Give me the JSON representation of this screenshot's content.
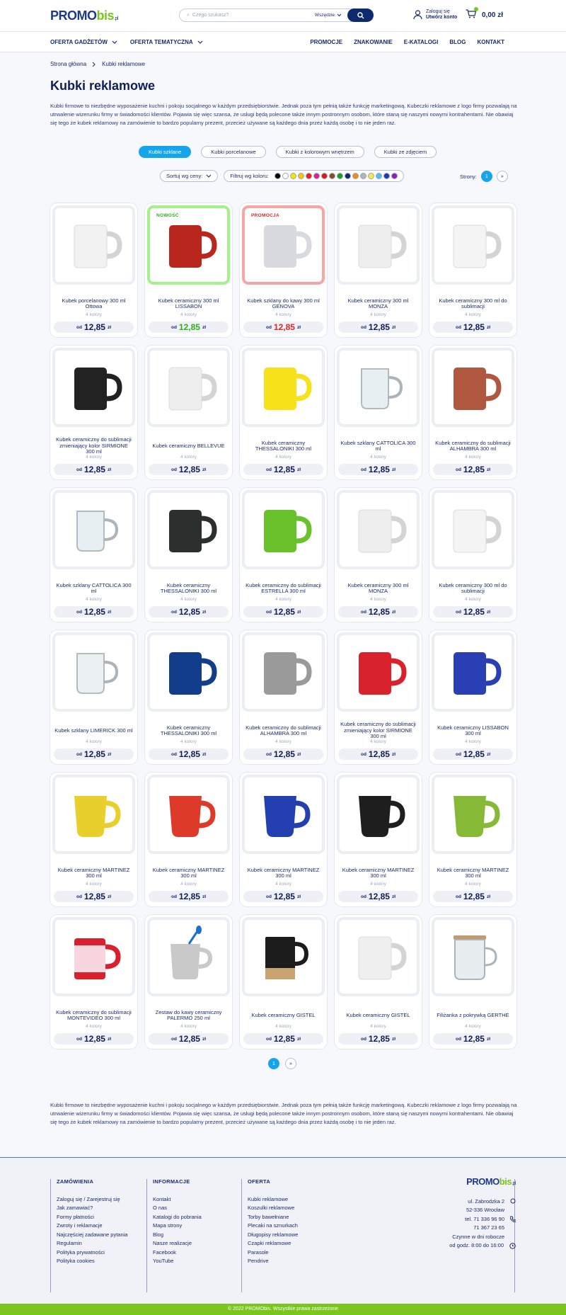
{
  "header": {
    "logo_main": "PROMO",
    "logo_accent": "bis",
    "logo_suffix": ".pl",
    "search_placeholder": "Czego szukasz?",
    "search_scope": "Wszędzie",
    "account_line1": "Zaloguj się",
    "account_line2": "Utwórz konto",
    "cart_total": "0,00 zł"
  },
  "nav": {
    "left": [
      "OFERTA GADŻETÓW",
      "OFERTA TEMATYCZNA"
    ],
    "right": [
      "PROMOCJE",
      "ZNAKOWANIE",
      "E-KATALOGI",
      "BLOG",
      "KONTAKT"
    ]
  },
  "breadcrumb": [
    "Strona główna",
    "Kubki reklamowe"
  ],
  "page_title": "Kubki reklamowe",
  "description": "Kubki firmowe to niezbędne wyposażenie kuchni i pokoju socjalnego w każdym przedsiębiorstwie. Jednak poza tym pełnią także funkcję marketingową. Kubeczki reklamowe z logo firmy pozwalają na utrwalenie wizerunku firmy w świadomości klientów. Pojawia się więc szansa, że usługi będą polecone także innym postronnym osobom, które staną się naszymi nowymi kontrahentami. Nie obawiaj się tego że kubek reklamowy na zamówienie to bardzo popularny prezent, przecież używane są każdego dnia przez każdą osobę i to nie jeden raz.",
  "categories": [
    "Kubki szklane",
    "Kubki porcelanowe",
    "Kubki z kolorowym wnętrzem",
    "Kubki ze zdjęciem"
  ],
  "sort_label": "Sortuj wg ceny:",
  "filter_label": "Filtruj wg koloru:",
  "swatch_colors": [
    "#000000",
    "#ffffff",
    "#f5e400",
    "#f7c600",
    "#f21d1d",
    "#e01f8f",
    "#d51b1b",
    "#8a4b24",
    "#1f9c2a",
    "#0f2a6e",
    "#f08a1e",
    "#b4b4b4",
    "#f5e94a",
    "#5bb8f0",
    "#1a3ab8",
    "#8a1fb8"
  ],
  "pages_label": "Strony:",
  "pages": {
    "current": "1",
    "next": "»"
  },
  "price_prefix": "od",
  "price_currency": "zł",
  "products": [
    {
      "name": "Kubek porcelanowy 300 ml Ottowa",
      "colors": "4 kolory",
      "price": "12,85",
      "badge": "",
      "mug": "#f2f2f2",
      "type": "white"
    },
    {
      "name": "Kubek ceramiczny 300 ml LISSABON",
      "colors": "4 kolory",
      "price": "12,85",
      "badge": "NOWOŚĆ",
      "mug": "#b8261e",
      "type": "solid"
    },
    {
      "name": "Kubek szklany do kawy 300 ml GENOVA",
      "colors": "4 kolory",
      "price": "12,85",
      "badge": "PROMOCJA",
      "mug": "#d8dadf",
      "type": "frosted"
    },
    {
      "name": "Kubek ceramiczny 300 ml MONZA",
      "colors": "4 kolory",
      "price": "12,85",
      "badge": "",
      "mug": "#eeeeee",
      "type": "white"
    },
    {
      "name": "Kubek ceramiczny 300 ml do sublimacji",
      "colors": "4 kolory",
      "price": "12,85",
      "badge": "",
      "mug": "#f4f4f4",
      "type": "white"
    },
    {
      "name": "Kubek ceramiczny do sublimacji zmieniający kolor SIRMIONE 300 ml",
      "colors": "4 kolory",
      "price": "12,85",
      "badge": "",
      "mug": "#222222",
      "type": "solid"
    },
    {
      "name": "Kubek ceramiczny BELLEVUE",
      "colors": "4 kolory",
      "price": "12,85",
      "badge": "",
      "mug": "#eeeeee",
      "type": "white"
    },
    {
      "name": "Kubek ceramiczny THESSALONIKI 300 ml",
      "colors": "4 kolory",
      "price": "12,85",
      "badge": "",
      "mug": "#f7e11a",
      "type": "solid"
    },
    {
      "name": "Kubek szklany CATTOLICA 300 ml",
      "colors": "4 kolory",
      "price": "12,85",
      "badge": "",
      "mug": "#e6eef2",
      "type": "glass"
    },
    {
      "name": "Kubek ceramiczny do sublimacji ALHAMBRA 300 ml",
      "colors": "4 kolory",
      "price": "12,85",
      "badge": "",
      "mug": "#b0573f",
      "type": "solid"
    },
    {
      "name": "Kubek szklany CATTOLICA 300 ml",
      "colors": "4 kolory",
      "price": "12,85",
      "badge": "",
      "mug": "#e6eef2",
      "type": "glass"
    },
    {
      "name": "Kubek ceramiczny THESSALONIKI 300 ml",
      "colors": "4 kolory",
      "price": "12,85",
      "badge": "",
      "mug": "#2b2f2e",
      "type": "solid"
    },
    {
      "name": "Kubek ceramiczny do sublimacji ESTRELLA 300 ml",
      "colors": "4 kolory",
      "price": "12,85",
      "badge": "",
      "mug": "#69c12c",
      "type": "solid"
    },
    {
      "name": "Kubek ceramiczny 300 ml MONZA",
      "colors": "4 kolory",
      "price": "12,85",
      "badge": "",
      "mug": "#eeeeee",
      "type": "white"
    },
    {
      "name": "Kubek ceramiczny 300 ml do sublimacji",
      "colors": "4 kolory",
      "price": "12,85",
      "badge": "",
      "mug": "#f4f4f4",
      "type": "white"
    },
    {
      "name": "Kubek szklany LIMERICK 300 ml",
      "colors": "4 kolory",
      "price": "12,85",
      "badge": "",
      "mug": "#e9efef",
      "type": "glass"
    },
    {
      "name": "Kubek ceramiczny THESSALONIKI 300 ml",
      "colors": "4 kolory",
      "price": "12,85",
      "badge": "",
      "mug": "#123d8a",
      "type": "solid"
    },
    {
      "name": "Kubek ceramiczny do sublimacji ALHAMBRA 300 ml",
      "colors": "4 kolory",
      "price": "12,85",
      "badge": "",
      "mug": "#9a9a9a",
      "type": "solid"
    },
    {
      "name": "Kubek ceramiczny do sublimacji zmieniający kolor SIRMIONE 300 ml",
      "colors": "4 kolory",
      "price": "12,85",
      "badge": "",
      "mug": "#d8232d",
      "type": "solid"
    },
    {
      "name": "Kubek ceramiczny LISSABON 300 ml",
      "colors": "4 kolory",
      "price": "12,85",
      "badge": "",
      "mug": "#2a3fb4",
      "type": "solid"
    },
    {
      "name": "Kubek ceramiczny MARTINEZ 300 ml",
      "colors": "4 kolory",
      "price": "12,85",
      "badge": "",
      "mug": "#e9cf2b",
      "type": "martinez"
    },
    {
      "name": "Kubek ceramiczny MARTINEZ 300 ml",
      "colors": "4 kolory",
      "price": "12,85",
      "badge": "",
      "mug": "#dd3a2a",
      "type": "martinez"
    },
    {
      "name": "Kubek ceramiczny MARTINEZ 300 ml",
      "colors": "4 kolory",
      "price": "12,85",
      "badge": "",
      "mug": "#2440b0",
      "type": "martinez"
    },
    {
      "name": "Kubek ceramiczny MARTINEZ 300 ml",
      "colors": "4 kolory",
      "price": "12,85",
      "badge": "",
      "mug": "#1e1e1e",
      "type": "martinez"
    },
    {
      "name": "Kubek ceramiczny MARTINEZ 300 ml",
      "colors": "4 kolory",
      "price": "12,85",
      "badge": "",
      "mug": "#85b936",
      "type": "martinez"
    },
    {
      "name": "Kubek ceramiczny do sublimacji MONTEVIDEO 300 ml",
      "colors": "4 kolory",
      "price": "12,85",
      "badge": "",
      "mug": "#d8202f",
      "type": "montevideo"
    },
    {
      "name": "Zestaw do kawy ceramiczny PALERMO 250 ml",
      "colors": "4 kolory",
      "price": "12,85",
      "badge": "",
      "mug": "#c9c9c9",
      "type": "spoon"
    },
    {
      "name": "Kubek ceramiczny GISTEL",
      "colors": "4 kolory",
      "price": "12,85",
      "badge": "",
      "mug": "#1c1c1c",
      "type": "cork"
    },
    {
      "name": "Kubek ceramiczny GISTEL",
      "colors": "4 kolory",
      "price": "12,85",
      "badge": "",
      "mug": "#efefef",
      "type": "white"
    },
    {
      "name": "Filiżanka z pokrywką GERTHE",
      "colors": "4 kolory",
      "price": "12,85",
      "badge": "",
      "mug": "#e8eef0",
      "type": "lid"
    }
  ],
  "footer": {
    "col1": {
      "title": "ZAMÓWIENIA",
      "items": [
        "Zaloguj się / Zarejestruj się",
        "Jak zamawiać?",
        "Formy płatności",
        "Zwroty i reklamacje",
        "Najczęściej zadawane pytania",
        "Regulamin",
        "Polityka prywatności",
        "Polityka cookies"
      ]
    },
    "col2": {
      "title": "INFORMACJE",
      "items": [
        "Kontakt",
        "O nas",
        "Katalogi do pobrania",
        "Mapa strony",
        "Blog",
        "Nasze realizacje",
        "Facebook",
        "YouTube"
      ]
    },
    "col3": {
      "title": "OFERTA",
      "items": [
        "Kubki reklamowe",
        "Koszulki reklamowe",
        "Torby bawełniane",
        "Plecaki na sznurkach",
        "Długopisy reklamowe",
        "Czapki reklamowe",
        "Parasole",
        "Pendrive"
      ]
    },
    "address1": "ul. Zabrodzka 2",
    "address2": "52-336 Wrocław",
    "phone1": "tel. 71 336 96 90",
    "phone2": "71 367 23 65",
    "hours1": "Czynne w dni robocze",
    "hours2": "od godz. 8:00 do 16:00"
  },
  "copyright": "© 2022 PROMObis. Wszystkie prawa zastrzeżone",
  "colors": {
    "accent": "#14a5ec",
    "brand_green": "#7ac61d",
    "navy": "#0e2a6e",
    "promo_red": "#d42a2a",
    "new_green": "#2faf1a"
  }
}
